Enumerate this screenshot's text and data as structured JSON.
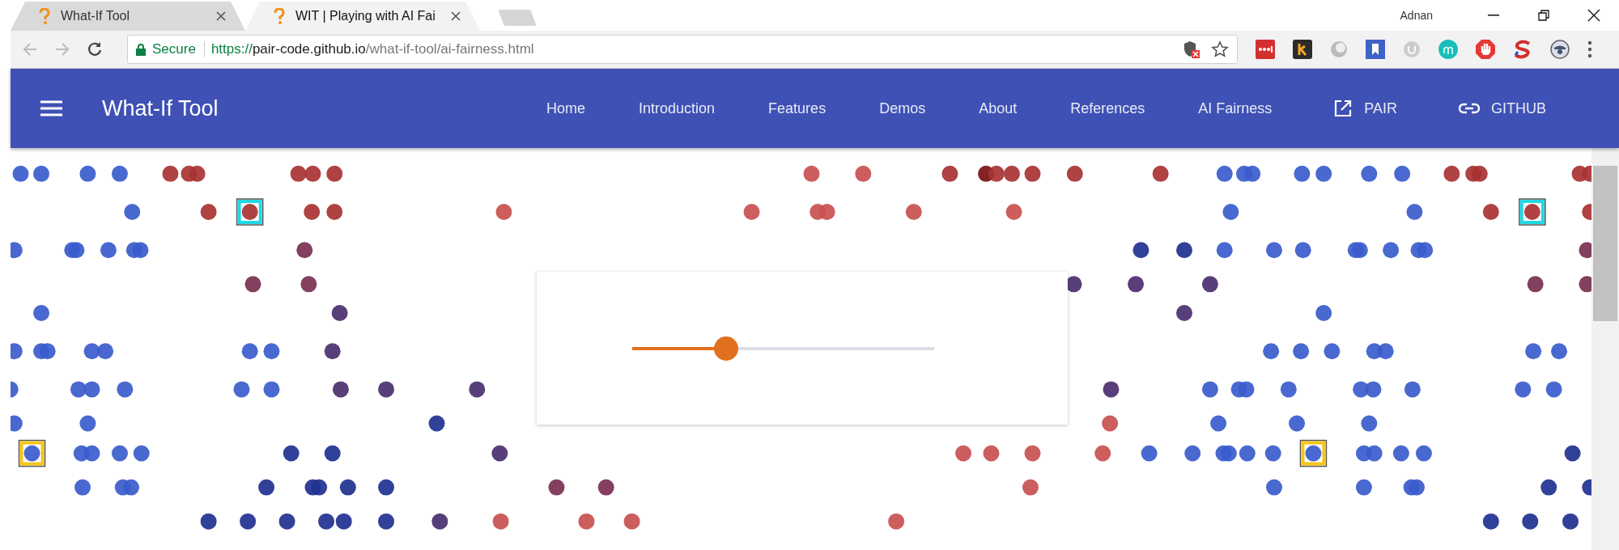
{
  "browser": {
    "tabs": [
      {
        "title": "What-If Tool",
        "selected": false
      },
      {
        "title": "WIT | Playing with AI Fai",
        "selected": true
      }
    ],
    "profile": "Adnan",
    "address": {
      "security": "Secure",
      "scheme": "https://",
      "host": "pair-code.github.io",
      "path": "/what-if-tool/ai-fairness.html"
    }
  },
  "navbar": {
    "title": "What-If Tool",
    "links": [
      {
        "label": "Home"
      },
      {
        "label": "Introduction"
      },
      {
        "label": "Features"
      },
      {
        "label": "Demos"
      },
      {
        "label": "About"
      },
      {
        "label": "References"
      },
      {
        "label": "AI Fairness"
      },
      {
        "label": "PAIR",
        "kind": "external"
      },
      {
        "label": "GITHUB",
        "kind": "chain"
      }
    ]
  },
  "slider": {
    "level": 0.31
  }
}
